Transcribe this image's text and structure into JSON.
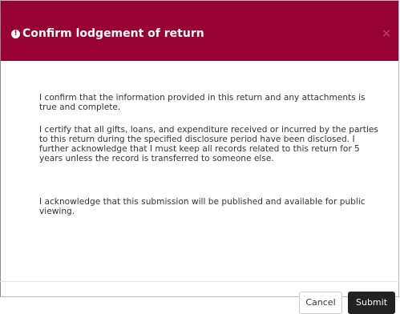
{
  "dialog": {
    "title": "Confirm lodgement of return",
    "info_icon_glyph": "!",
    "close_glyph": "×",
    "colors": {
      "header_background": "#990033",
      "header_text": "#ffffff",
      "submit_background": "#222222"
    }
  },
  "body": {
    "paragraphs": [
      "I confirm that the information provided in this return and any attachments is true and complete.",
      "I certify that all gifts, loans, and expenditure received or incurred by the parties to this return during the specified disclosure period have been disclosed. I further acknowledge that I must keep all records related to this return for 5 years unless the record is transferred to someone else.",
      "I acknowledge that this submission will be published and available for public viewing."
    ]
  },
  "footer": {
    "cancel_label": "Cancel",
    "submit_label": "Submit"
  }
}
